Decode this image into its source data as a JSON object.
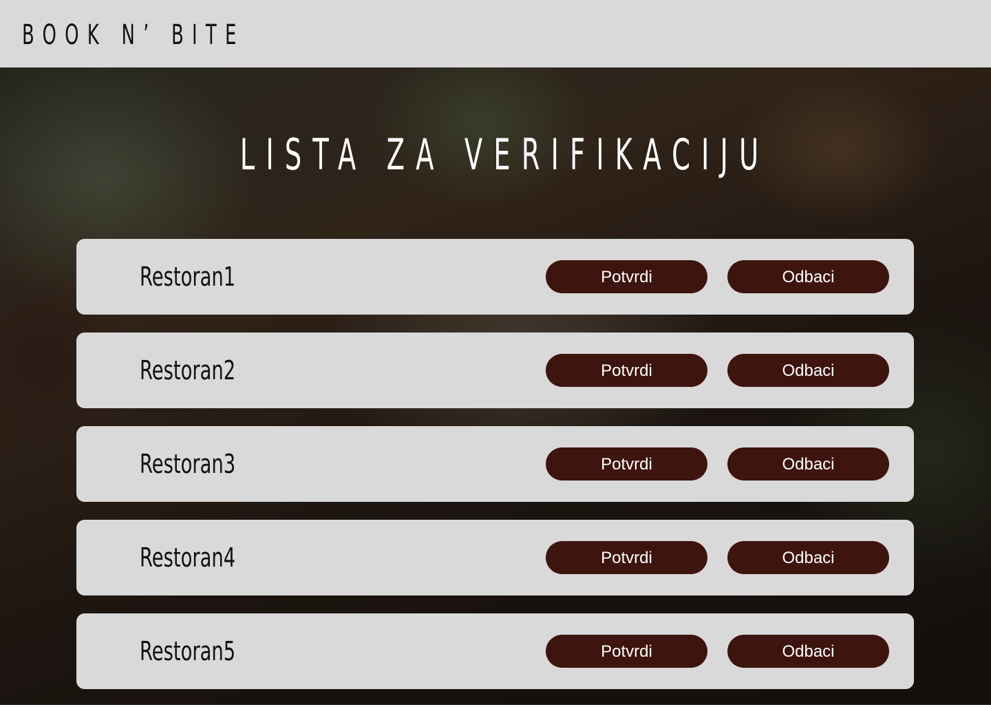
{
  "header": {
    "brand": "BOOK N’ BITE",
    "background_color": "#d9d9d9"
  },
  "hero": {
    "title": "LISTA ZA VERIFIKACIJU"
  },
  "restaurants": [
    {
      "name": "Restoran1",
      "confirm_label": "Potvrdi",
      "reject_label": "Odbaci"
    },
    {
      "name": "Restoran2",
      "confirm_label": "Potvrdi",
      "reject_label": "Odbaci"
    },
    {
      "name": "Restoran3",
      "confirm_label": "Potvrdi",
      "reject_label": "Odbaci"
    },
    {
      "name": "Restoran4",
      "confirm_label": "Potvrdi",
      "reject_label": "Odbaci"
    },
    {
      "name": "Restoran5",
      "confirm_label": "Potvrdi",
      "reject_label": "Odbaci"
    }
  ],
  "colors": {
    "button_bg": "#3e140e",
    "button_text": "#ffffff",
    "card_bg": "#d9d9d9"
  }
}
